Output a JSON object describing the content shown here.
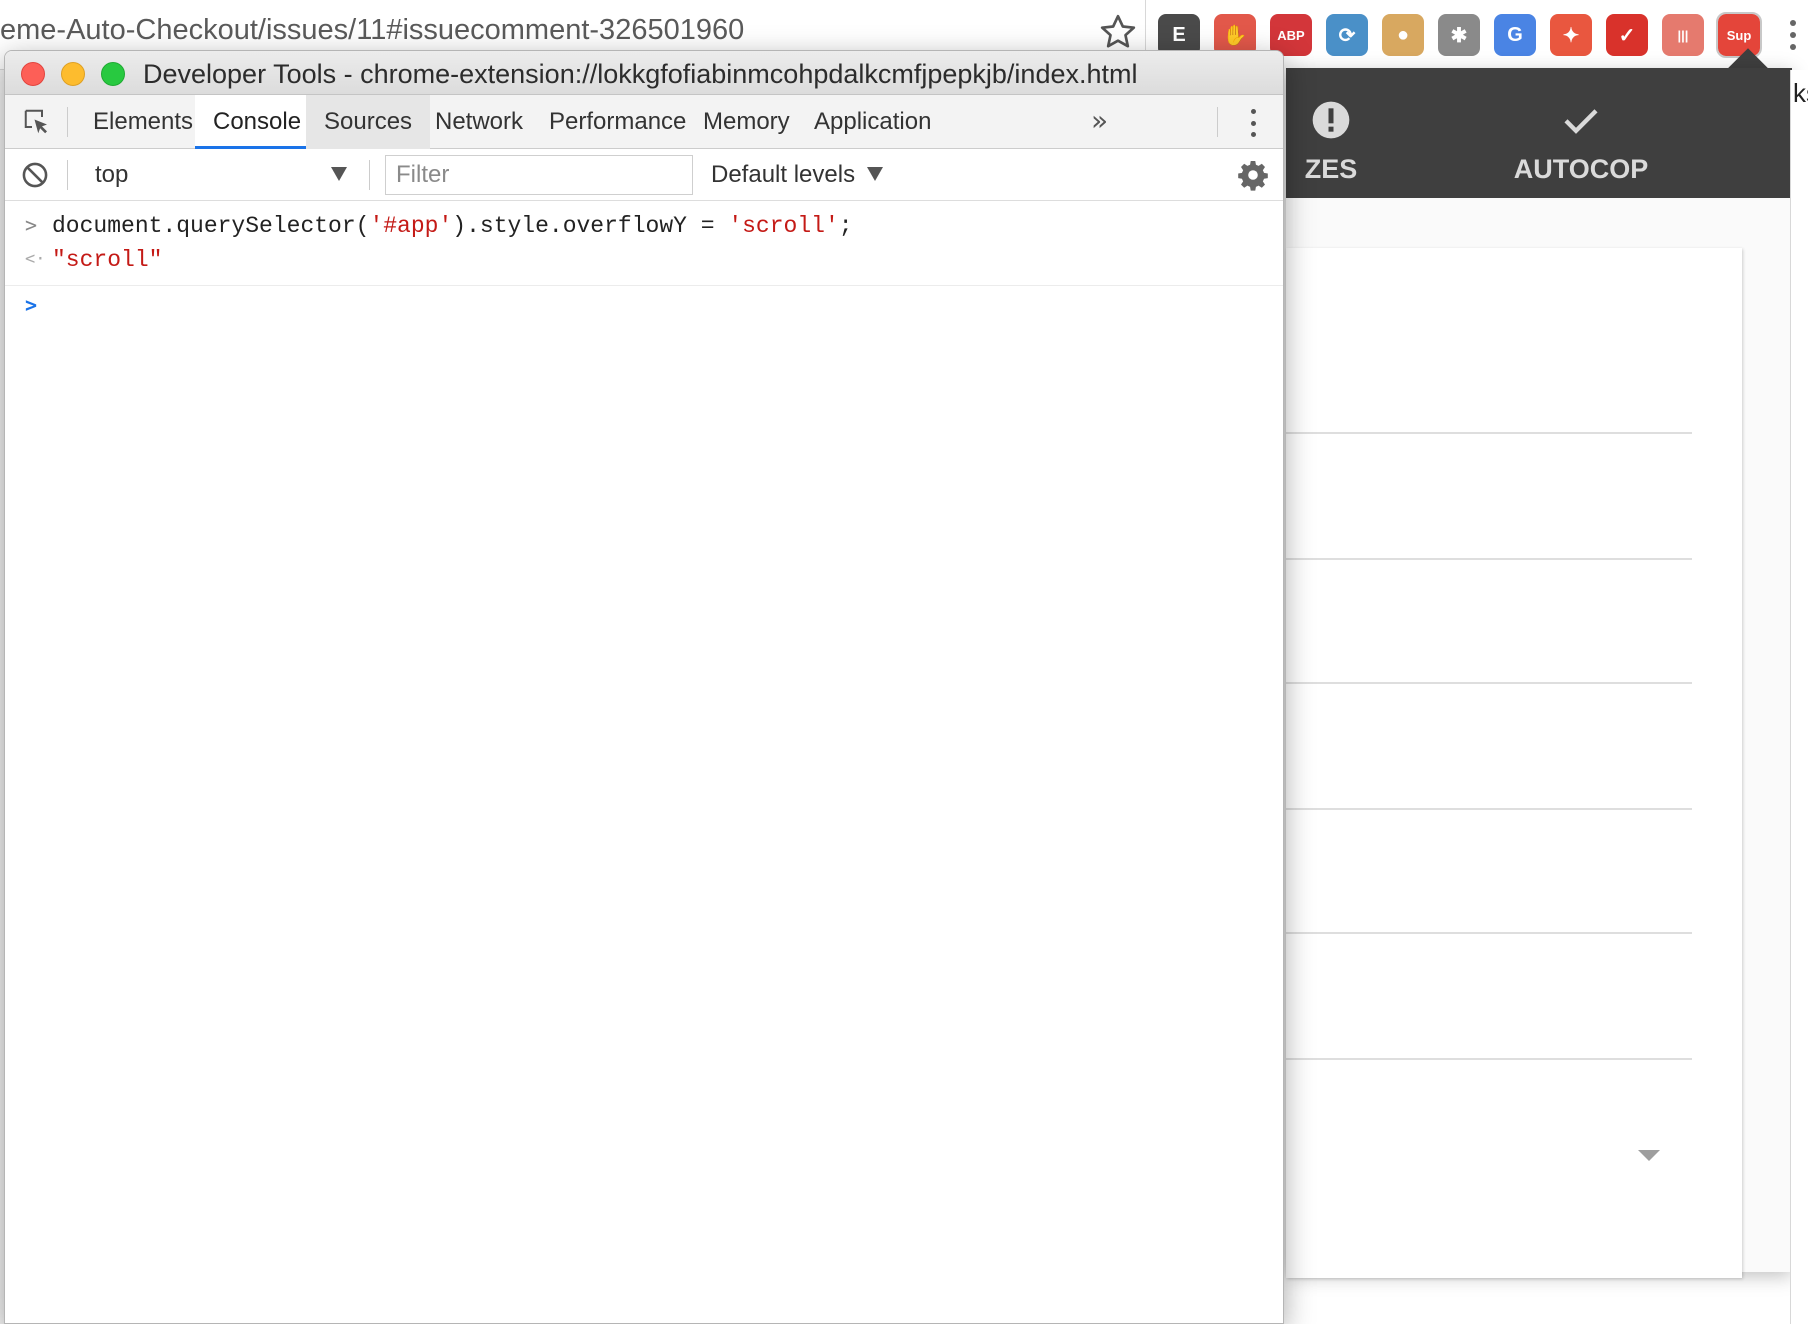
{
  "browser": {
    "url_fragment": "eme-Auto-Checkout/issues/11#issuecomment-326501960",
    "extensions": [
      {
        "name": "evernote-icon",
        "label": "E",
        "color": "#4a4a4a"
      },
      {
        "name": "hand-stop-icon",
        "label": "✋",
        "color": "#e2584a"
      },
      {
        "name": "adblock-plus-icon",
        "label": "ABP",
        "color": "#d3363a"
      },
      {
        "name": "sync-icon",
        "label": "⟳",
        "color": "#4a90c8"
      },
      {
        "name": "cookie-icon",
        "label": "●",
        "color": "#d8a860"
      },
      {
        "name": "bug-icon",
        "label": "✱",
        "color": "#8a8a8a"
      },
      {
        "name": "google-translate-icon",
        "label": "G",
        "color": "#4a84e4"
      },
      {
        "name": "magic-wand-icon",
        "label": "✦",
        "color": "#e9573f"
      },
      {
        "name": "vpn-icon",
        "label": "✓",
        "color": "#d9322b"
      },
      {
        "name": "barcode-icon",
        "label": "|||",
        "color": "#e57a6e"
      },
      {
        "name": "supreme-extension-icon",
        "label": "Sup",
        "color": "#e4453a"
      }
    ],
    "right_edge_text": "ks"
  },
  "popup": {
    "tabs": [
      {
        "label": "ZES",
        "icon": "alert-icon"
      },
      {
        "label": "AUTOCOP",
        "icon": "check-icon"
      }
    ],
    "form_rows": 6
  },
  "devtools": {
    "title": "Developer Tools - chrome-extension://lokkgfofiabinmcohpdalkcmfjpepkjb/index.html",
    "tabs": [
      {
        "label": "Elements",
        "state": "normal"
      },
      {
        "label": "Console",
        "state": "active"
      },
      {
        "label": "Sources",
        "state": "hover"
      },
      {
        "label": "Network",
        "state": "normal"
      },
      {
        "label": "Performance",
        "state": "normal"
      },
      {
        "label": "Memory",
        "state": "normal"
      },
      {
        "label": "Application",
        "state": "normal"
      }
    ],
    "more_tabs_label": "»",
    "toolbar": {
      "context": "top",
      "filter_placeholder": "Filter",
      "levels": "Default levels"
    },
    "console": {
      "input": {
        "prefix": "document.querySelector(",
        "arg": "'#app'",
        "middle": ").style.overflowY = ",
        "value": "'scroll'",
        "suffix": ";"
      },
      "output": "\"scroll\"",
      "input_marker": ">",
      "output_marker": "<·",
      "prompt_marker": ">"
    }
  },
  "colors": {
    "accent": "#1a73e8",
    "string": "#c41a16",
    "popup_header": "#3f3f3f"
  }
}
